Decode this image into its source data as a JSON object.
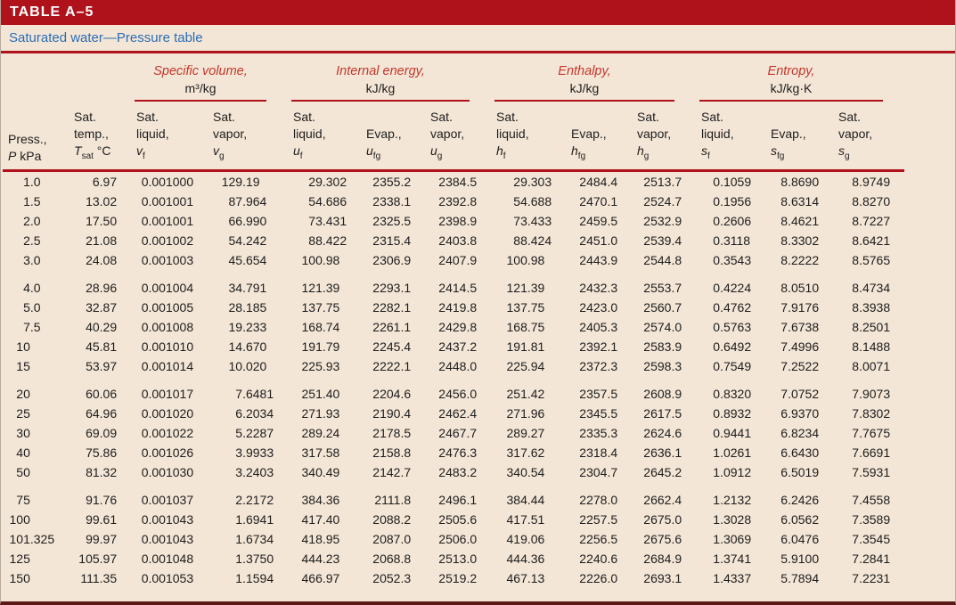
{
  "title": "TABLE A–5",
  "subtitle": "Saturated water—Pressure table",
  "colors": {
    "header_bar": "#b0121c",
    "subtitle_text": "#2a6db4",
    "rule": "#b0121c",
    "group_label": "#c2372c",
    "background": "#f4e6d6"
  },
  "table": {
    "groups": [
      {
        "label": "",
        "unit": "",
        "span": 2
      },
      {
        "label": "Specific volume,",
        "unit": "m³/kg",
        "span": 2
      },
      {
        "label": "Internal energy,",
        "unit": "kJ/kg",
        "span": 3
      },
      {
        "label": "Enthalpy,",
        "unit": "kJ/kg",
        "span": 3
      },
      {
        "label": "Entropy,",
        "unit": "kJ/kg·K",
        "span": 3
      }
    ],
    "columns": [
      {
        "l1": "",
        "l2": "Press.,",
        "base": "P",
        "sub": "",
        "after": " kPa"
      },
      {
        "l1": "Sat.",
        "l2": "temp.,",
        "base": "T",
        "sub": "sat",
        "after": " °C"
      },
      {
        "l1": "Sat.",
        "l2": "liquid,",
        "base": "v",
        "sub": "f",
        "after": ""
      },
      {
        "l1": "Sat.",
        "l2": "vapor,",
        "base": "v",
        "sub": "g",
        "after": ""
      },
      {
        "l1": "Sat.",
        "l2": "liquid,",
        "base": "u",
        "sub": "f",
        "after": ""
      },
      {
        "l1": "",
        "l2": "Evap.,",
        "base": "u",
        "sub": "fg",
        "after": ""
      },
      {
        "l1": "Sat.",
        "l2": "vapor,",
        "base": "u",
        "sub": "g",
        "after": ""
      },
      {
        "l1": "Sat.",
        "l2": "liquid,",
        "base": "h",
        "sub": "f",
        "after": ""
      },
      {
        "l1": "",
        "l2": "Evap.,",
        "base": "h",
        "sub": "fg",
        "after": ""
      },
      {
        "l1": "Sat.",
        "l2": "vapor,",
        "base": "h",
        "sub": "g",
        "after": ""
      },
      {
        "l1": "Sat.",
        "l2": "liquid,",
        "base": "s",
        "sub": "f",
        "after": ""
      },
      {
        "l1": "",
        "l2": "Evap.,",
        "base": "s",
        "sub": "fg",
        "after": ""
      },
      {
        "l1": "Sat.",
        "l2": "vapor,",
        "base": "s",
        "sub": "g",
        "after": ""
      }
    ],
    "group_size": 5,
    "rows": [
      [
        "1.0",
        "6.97",
        "0.001000",
        "129.19",
        "29.302",
        "2355.2",
        "2384.5",
        "29.303",
        "2484.4",
        "2513.7",
        "0.1059",
        "8.8690",
        "8.9749"
      ],
      [
        "1.5",
        "13.02",
        "0.001001",
        "87.964",
        "54.686",
        "2338.1",
        "2392.8",
        "54.688",
        "2470.1",
        "2524.7",
        "0.1956",
        "8.6314",
        "8.8270"
      ],
      [
        "2.0",
        "17.50",
        "0.001001",
        "66.990",
        "73.431",
        "2325.5",
        "2398.9",
        "73.433",
        "2459.5",
        "2532.9",
        "0.2606",
        "8.4621",
        "8.7227"
      ],
      [
        "2.5",
        "21.08",
        "0.001002",
        "54.242",
        "88.422",
        "2315.4",
        "2403.8",
        "88.424",
        "2451.0",
        "2539.4",
        "0.3118",
        "8.3302",
        "8.6421"
      ],
      [
        "3.0",
        "24.08",
        "0.001003",
        "45.654",
        "100.98",
        "2306.9",
        "2407.9",
        "100.98",
        "2443.9",
        "2544.8",
        "0.3543",
        "8.2222",
        "8.5765"
      ],
      [
        "4.0",
        "28.96",
        "0.001004",
        "34.791",
        "121.39",
        "2293.1",
        "2414.5",
        "121.39",
        "2432.3",
        "2553.7",
        "0.4224",
        "8.0510",
        "8.4734"
      ],
      [
        "5.0",
        "32.87",
        "0.001005",
        "28.185",
        "137.75",
        "2282.1",
        "2419.8",
        "137.75",
        "2423.0",
        "2560.7",
        "0.4762",
        "7.9176",
        "8.3938"
      ],
      [
        "7.5",
        "40.29",
        "0.001008",
        "19.233",
        "168.74",
        "2261.1",
        "2429.8",
        "168.75",
        "2405.3",
        "2574.0",
        "0.5763",
        "7.6738",
        "8.2501"
      ],
      [
        "10",
        "45.81",
        "0.001010",
        "14.670",
        "191.79",
        "2245.4",
        "2437.2",
        "191.81",
        "2392.1",
        "2583.9",
        "0.6492",
        "7.4996",
        "8.1488"
      ],
      [
        "15",
        "53.97",
        "0.001014",
        "10.020",
        "225.93",
        "2222.1",
        "2448.0",
        "225.94",
        "2372.3",
        "2598.3",
        "0.7549",
        "7.2522",
        "8.0071"
      ],
      [
        "20",
        "60.06",
        "0.001017",
        "7.6481",
        "251.40",
        "2204.6",
        "2456.0",
        "251.42",
        "2357.5",
        "2608.9",
        "0.8320",
        "7.0752",
        "7.9073"
      ],
      [
        "25",
        "64.96",
        "0.001020",
        "6.2034",
        "271.93",
        "2190.4",
        "2462.4",
        "271.96",
        "2345.5",
        "2617.5",
        "0.8932",
        "6.9370",
        "7.8302"
      ],
      [
        "30",
        "69.09",
        "0.001022",
        "5.2287",
        "289.24",
        "2178.5",
        "2467.7",
        "289.27",
        "2335.3",
        "2624.6",
        "0.9441",
        "6.8234",
        "7.7675"
      ],
      [
        "40",
        "75.86",
        "0.001026",
        "3.9933",
        "317.58",
        "2158.8",
        "2476.3",
        "317.62",
        "2318.4",
        "2636.1",
        "1.0261",
        "6.6430",
        "7.6691"
      ],
      [
        "50",
        "81.32",
        "0.001030",
        "3.2403",
        "340.49",
        "2142.7",
        "2483.2",
        "340.54",
        "2304.7",
        "2645.2",
        "1.0912",
        "6.5019",
        "7.5931"
      ],
      [
        "75",
        "91.76",
        "0.001037",
        "2.2172",
        "384.36",
        "2111.8",
        "2496.1",
        "384.44",
        "2278.0",
        "2662.4",
        "1.2132",
        "6.2426",
        "7.4558"
      ],
      [
        "100",
        "99.61",
        "0.001043",
        "1.6941",
        "417.40",
        "2088.2",
        "2505.6",
        "417.51",
        "2257.5",
        "2675.0",
        "1.3028",
        "6.0562",
        "7.3589"
      ],
      [
        "101.325",
        "99.97",
        "0.001043",
        "1.6734",
        "418.95",
        "2087.0",
        "2506.0",
        "419.06",
        "2256.5",
        "2675.6",
        "1.3069",
        "6.0476",
        "7.3545"
      ],
      [
        "125",
        "105.97",
        "0.001048",
        "1.3750",
        "444.23",
        "2068.8",
        "2513.0",
        "444.36",
        "2240.6",
        "2684.9",
        "1.3741",
        "5.9100",
        "7.2841"
      ],
      [
        "150",
        "111.35",
        "0.001053",
        "1.1594",
        "466.97",
        "2052.3",
        "2519.2",
        "467.13",
        "2226.0",
        "2693.1",
        "1.4337",
        "5.7894",
        "7.2231"
      ]
    ]
  }
}
